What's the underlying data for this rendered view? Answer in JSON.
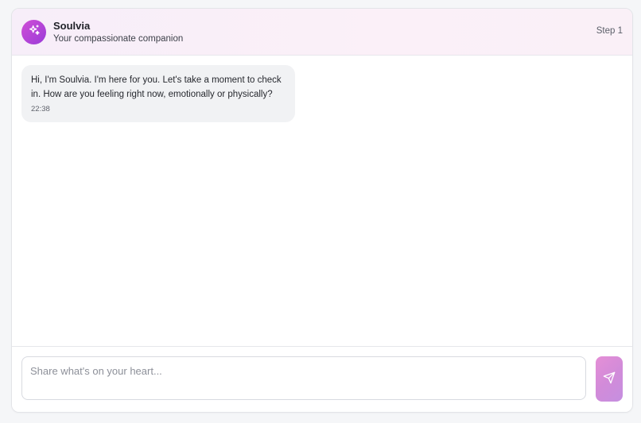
{
  "header": {
    "title": "Soulvia",
    "subtitle": "Your compassionate companion",
    "step": "Step 1",
    "avatar_icon": "sparkles-icon"
  },
  "messages": [
    {
      "sender": "assistant",
      "text": "Hi, I'm Soulvia. I'm here for you. Let's take a moment to check in. How are you feeling right now, emotionally or physically?",
      "time": "22:38"
    }
  ],
  "composer": {
    "placeholder": "Share what's on your heart...",
    "value": "",
    "send_icon": "send-icon"
  },
  "colors": {
    "accent_start": "#d04fd6",
    "accent_end": "#9a3bd8",
    "send_button": "#d28bd9",
    "bubble_bg": "#f1f2f4"
  }
}
